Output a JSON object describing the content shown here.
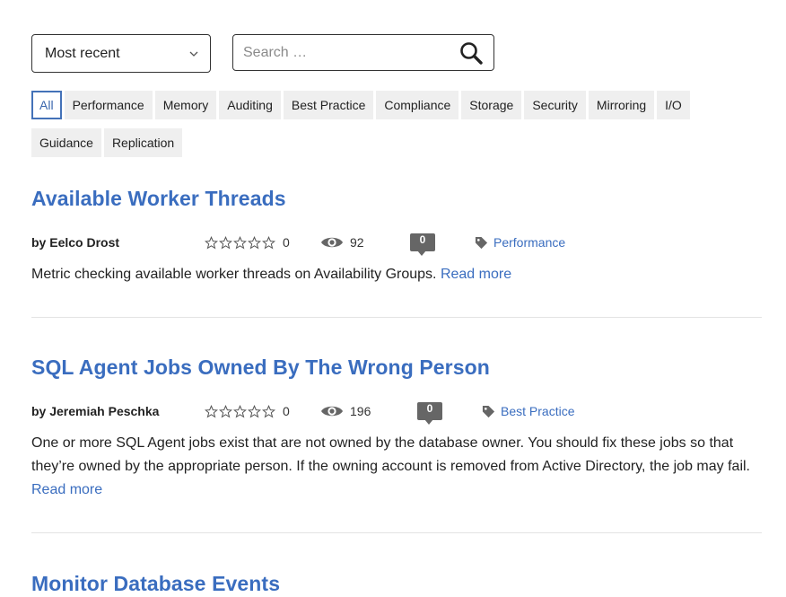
{
  "controls": {
    "sort_value": "Most recent",
    "search_placeholder": "Search …"
  },
  "filters": [
    {
      "label": "All",
      "active": true
    },
    {
      "label": "Performance"
    },
    {
      "label": "Memory"
    },
    {
      "label": "Auditing"
    },
    {
      "label": "Best Practice"
    },
    {
      "label": "Compliance"
    },
    {
      "label": "Storage"
    },
    {
      "label": "Security"
    },
    {
      "label": "Mirroring"
    },
    {
      "label": "I/O"
    },
    {
      "label": "Guidance"
    },
    {
      "label": "Replication"
    }
  ],
  "posts": [
    {
      "title": "Available Worker Threads",
      "author": "by Eelco Drost",
      "rating": "0",
      "views": "92",
      "comments": "0",
      "tag": "Performance",
      "excerpt": "Metric checking available worker threads on Availability Groups.",
      "read_more": "Read more"
    },
    {
      "title": "SQL Agent Jobs Owned By The Wrong Person",
      "author": "by Jeremiah Peschka",
      "rating": "0",
      "views": "196",
      "comments": "0",
      "tag": "Best Practice",
      "excerpt": "One or more SQL Agent jobs exist that are not owned by the database owner. You should fix these jobs so that they’re owned by the appropriate person. If the owning account is removed from Active Directory, the job may fail.",
      "read_more": "Read more"
    },
    {
      "title": "Monitor Database Events"
    }
  ],
  "icons": {
    "sort": "chevron-down-icon",
    "search": "search-icon",
    "rating": "star-outline-icon",
    "views": "eye-icon",
    "comments": "comment-bubble-icon",
    "tag": "tag-icon"
  },
  "colors": {
    "accent": "#3a6dbf",
    "chip_bg": "#efefef",
    "active_border": "#4472b8",
    "icon_gray": "#666666"
  }
}
